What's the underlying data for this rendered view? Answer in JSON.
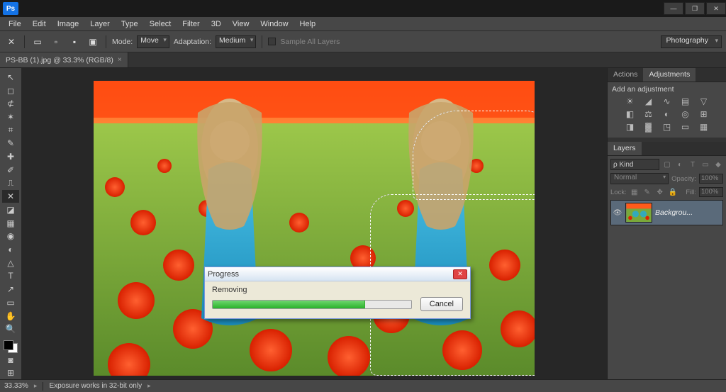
{
  "app_logo_text": "Ps",
  "menubar": [
    "File",
    "Edit",
    "Image",
    "Layer",
    "Type",
    "Select",
    "Filter",
    "3D",
    "View",
    "Window",
    "Help"
  ],
  "optbar": {
    "mode_label": "Mode:",
    "mode_value": "Move",
    "adapt_label": "Adaptation:",
    "adapt_value": "Medium",
    "sample_label": "Sample All Layers"
  },
  "workspace": "Photography",
  "doc_tab": "PS-BB (1).jpg @ 33.3% (RGB/8)",
  "dialog": {
    "title": "Progress",
    "status": "Removing",
    "progress_pct": 77,
    "cancel": "Cancel"
  },
  "panel_actions": "Actions",
  "panel_adjustments": "Adjustments",
  "adjustments_hint": "Add an adjustment",
  "panel_layers": "Layers",
  "layers": {
    "filter_kind": "ρ Kind",
    "blend": "Normal",
    "opacity_label": "Opacity:",
    "opacity_value": "100%",
    "lock_label": "Lock:",
    "fill_label": "Fill:",
    "fill_value": "100%",
    "layer0_name": "Backgrou..."
  },
  "status": {
    "zoom": "33.33%",
    "info": "Exposure works in 32-bit only"
  }
}
